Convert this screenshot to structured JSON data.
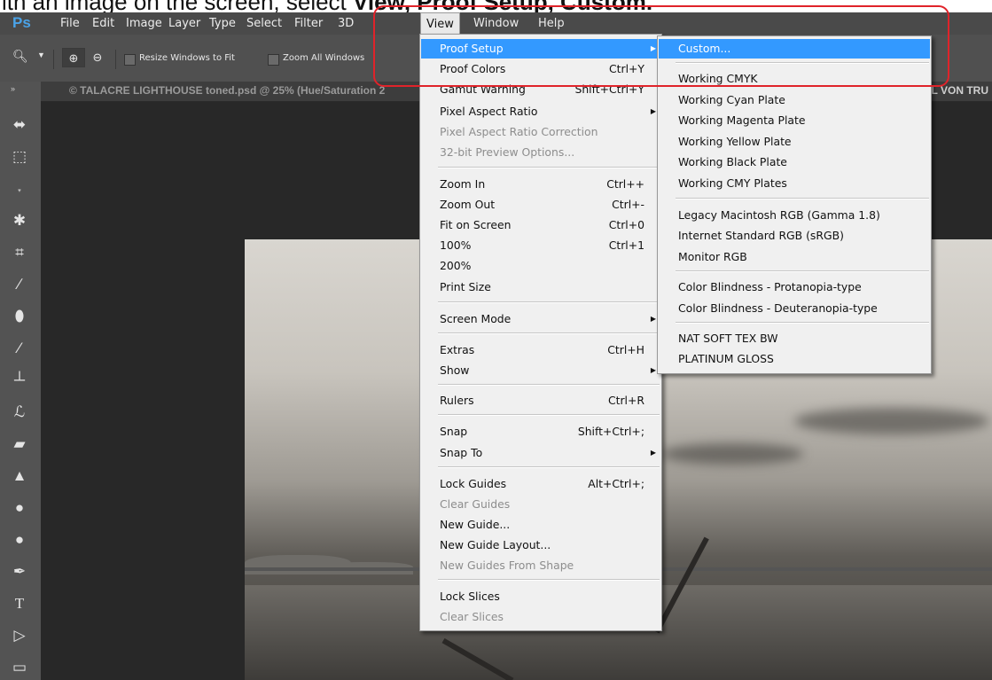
{
  "instruction": {
    "prefix": "ith an image on the screen, select ",
    "bold": "View, Proof Setup, Custom."
  },
  "menubar": {
    "logo": "Ps",
    "items": [
      "File",
      "Edit",
      "Image",
      "Layer",
      "Type",
      "Select",
      "Filter",
      "3D",
      "View",
      "Window",
      "Help"
    ],
    "active": "View"
  },
  "options_bar": {
    "resize_windows_label": "Resize Windows to Fit",
    "zoom_all_label": "Zoom All Windows"
  },
  "document": {
    "title": "© TALACRE LIGHTHOUSE toned.psd @ 25% (Hue/Saturation 2",
    "right_text": "L VON TRU"
  },
  "view_menu": {
    "proof_setup": "Proof Setup",
    "proof_colors": "Proof Colors",
    "proof_colors_sc": "Ctrl+Y",
    "gamut_warning": "Gamut Warning",
    "gamut_warning_sc": "Shift+Ctrl+Y",
    "pixel_aspect_ratio": "Pixel Aspect Ratio",
    "pixel_aspect_ratio_correction": "Pixel Aspect Ratio Correction",
    "preview_32bit": "32-bit Preview Options...",
    "zoom_in": "Zoom In",
    "zoom_in_sc": "Ctrl++",
    "zoom_out": "Zoom Out",
    "zoom_out_sc": "Ctrl+-",
    "fit_on_screen": "Fit on Screen",
    "fit_on_screen_sc": "Ctrl+0",
    "pct100": "100%",
    "pct100_sc": "Ctrl+1",
    "pct200": "200%",
    "print_size": "Print Size",
    "screen_mode": "Screen Mode",
    "extras": "Extras",
    "extras_sc": "Ctrl+H",
    "show": "Show",
    "rulers": "Rulers",
    "rulers_sc": "Ctrl+R",
    "snap": "Snap",
    "snap_sc": "Shift+Ctrl+;",
    "snap_to": "Snap To",
    "lock_guides": "Lock Guides",
    "lock_guides_sc": "Alt+Ctrl+;",
    "clear_guides": "Clear Guides",
    "new_guide": "New Guide...",
    "new_guide_layout": "New Guide Layout...",
    "new_guides_from_shape": "New Guides From Shape",
    "lock_slices": "Lock Slices",
    "clear_slices": "Clear Slices"
  },
  "proof_submenu": {
    "custom": "Custom...",
    "working_cmyk": "Working CMYK",
    "cyan": "Working Cyan Plate",
    "magenta": "Working Magenta Plate",
    "yellow": "Working Yellow Plate",
    "black": "Working Black Plate",
    "cmy": "Working CMY Plates",
    "legacy_mac": "Legacy Macintosh RGB (Gamma 1.8)",
    "srgb": "Internet Standard RGB (sRGB)",
    "monitor": "Monitor RGB",
    "protanopia": "Color Blindness - Protanopia-type",
    "deuteranopia": "Color Blindness - Deuteranopia-type",
    "nat_soft": "NAT SOFT TEX BW",
    "platinum": "PLATINUM GLOSS"
  },
  "colors": {
    "highlight": "#3399ff",
    "callout": "#e0232a",
    "ps_blue": "#4aa3e8"
  }
}
